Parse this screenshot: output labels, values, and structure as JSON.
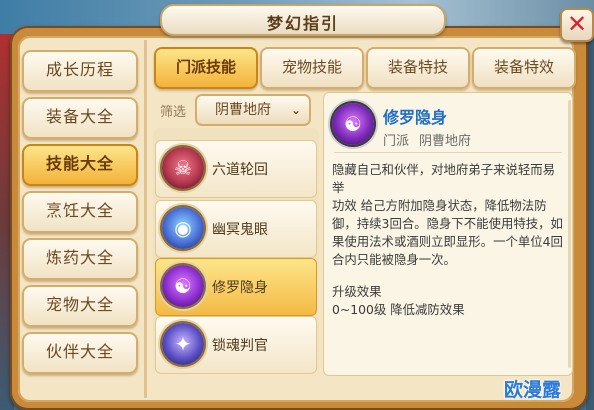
{
  "window": {
    "title": "梦幻指引",
    "close_glyph": "✕"
  },
  "sidebar": {
    "items": [
      {
        "label": "成长历程",
        "active": false
      },
      {
        "label": "装备大全",
        "active": false
      },
      {
        "label": "技能大全",
        "active": true
      },
      {
        "label": "烹饪大全",
        "active": false
      },
      {
        "label": "炼药大全",
        "active": false
      },
      {
        "label": "宠物大全",
        "active": false
      },
      {
        "label": "伙伴大全",
        "active": false
      }
    ]
  },
  "tabs": [
    {
      "label": "门派技能",
      "active": true
    },
    {
      "label": "宠物技能",
      "active": false
    },
    {
      "label": "装备特技",
      "active": false
    },
    {
      "label": "装备特效",
      "active": false
    }
  ],
  "filter": {
    "label": "筛选",
    "value": "阴曹地府"
  },
  "skills": [
    {
      "name": "六道轮回",
      "icon": "skull-icon",
      "color": "#b4364e"
    },
    {
      "name": "幽冥鬼眼",
      "icon": "ghost-eye-icon",
      "color": "#4a6fd6"
    },
    {
      "name": "修罗隐身",
      "icon": "shadow-icon",
      "color": "#8a2ed0",
      "active": true
    },
    {
      "name": "锁魂判官",
      "icon": "soul-lock-icon",
      "color": "#5a4ec4"
    }
  ],
  "detail": {
    "title": "修罗隐身",
    "type_label": "门派",
    "school": "阴曹地府",
    "description": "隐藏自己和伙伴，对地府弟子来说轻而易举\n功效 给己方附加隐身状态，降低物法防御，持续3回合。隐身下不能使用特技，如果使用法术或酒则立即显形。一个单位4回合内只能被隐身一次。",
    "upgrade_title": "升级效果",
    "upgrade_text": "0~100级 降低减防效果"
  },
  "watermark": "欧漫露",
  "colors": {
    "accent_gold": "#f2b33a",
    "title_blue": "#1f6ec9",
    "close_red": "#d9232a"
  }
}
